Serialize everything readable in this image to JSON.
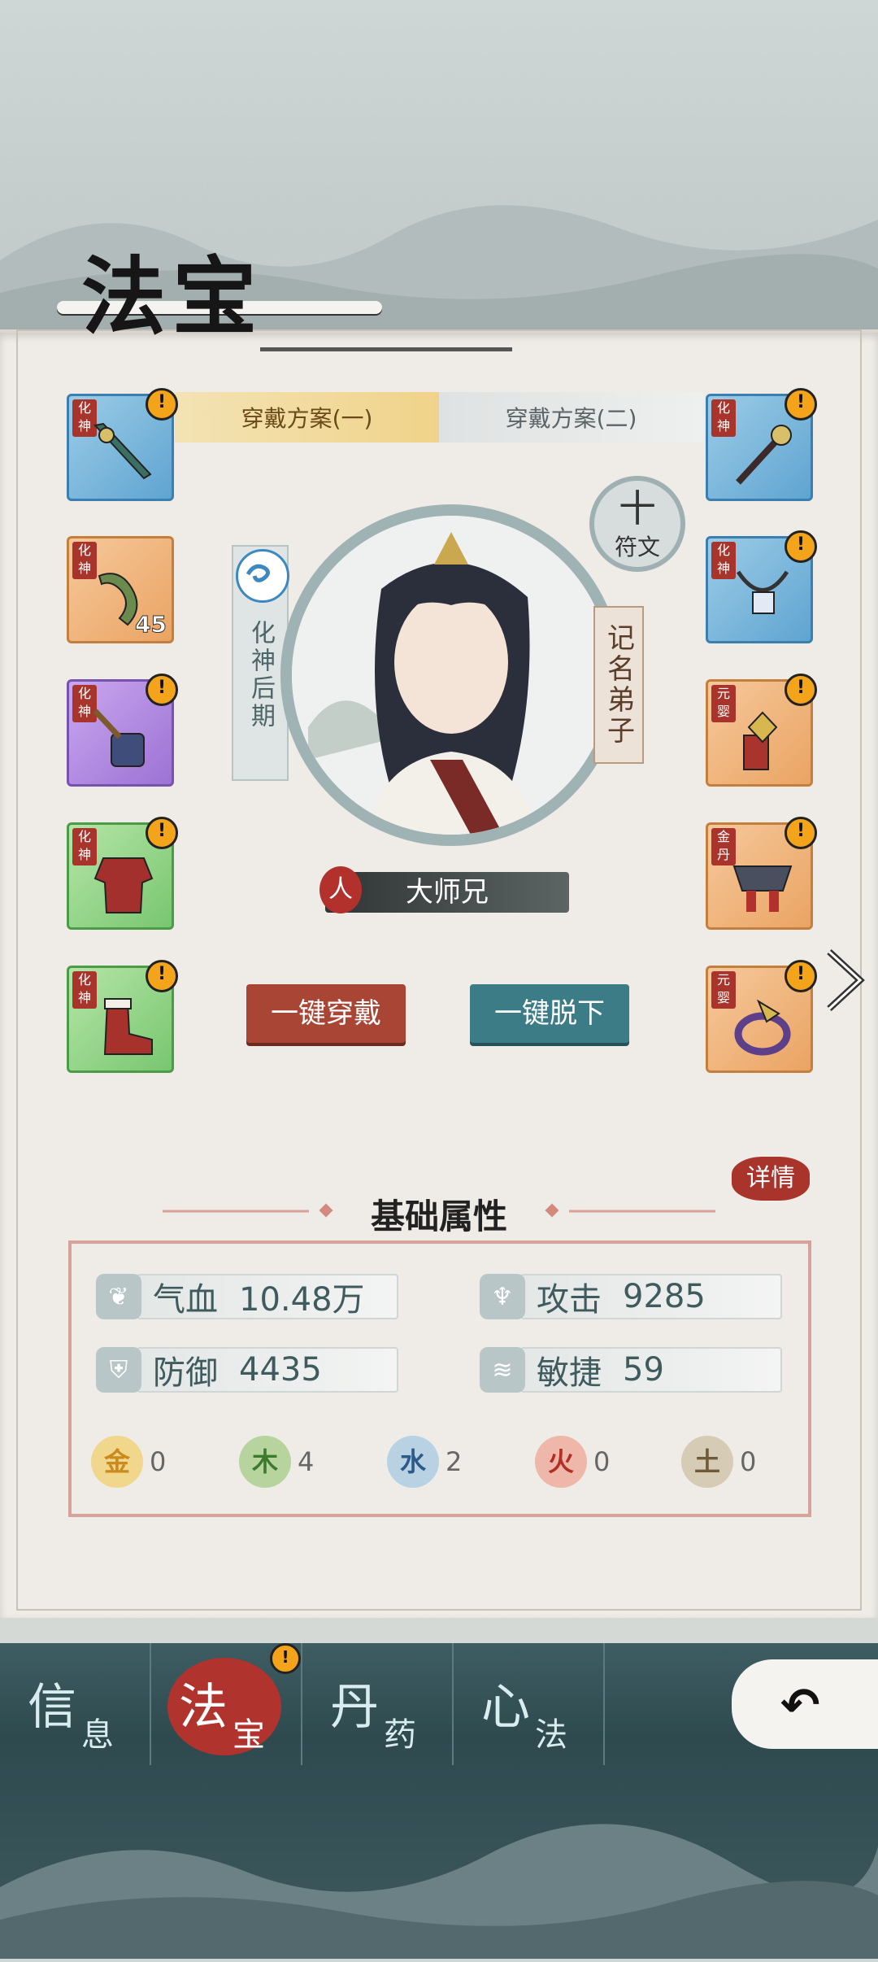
{
  "page": {
    "title": "法宝"
  },
  "loadout_tabs": [
    "穿戴方案(一)",
    "穿戴方案(二)"
  ],
  "left_slots": [
    {
      "tier": "化神",
      "rarity": "blue",
      "item": "jade-sword",
      "alert": "!"
    },
    {
      "tier": "化神",
      "rarity": "orange",
      "item": "dragon-blade",
      "level": "45"
    },
    {
      "tier": "化神",
      "rarity": "purple",
      "item": "crystal-hammer",
      "alert": "!"
    },
    {
      "tier": "化神",
      "rarity": "green",
      "item": "red-robe",
      "alert": "!"
    },
    {
      "tier": "化神",
      "rarity": "green",
      "item": "fur-boots",
      "alert": "!"
    }
  ],
  "right_slots": [
    {
      "tier": "化神",
      "rarity": "blue",
      "item": "hairpin",
      "alert": "!"
    },
    {
      "tier": "化神",
      "rarity": "blue",
      "item": "jade-necklace",
      "alert": "!"
    },
    {
      "tier": "元婴",
      "rarity": "orange",
      "item": "gem-bracer",
      "alert": "!"
    },
    {
      "tier": "金丹",
      "rarity": "orange",
      "item": "belt",
      "alert": "!"
    },
    {
      "tier": "元婴",
      "rarity": "orange",
      "item": "dragon-ring",
      "alert": "!"
    }
  ],
  "character": {
    "realm": "化神后期",
    "rank": "记名弟子",
    "race": "人",
    "name": "大师兄",
    "rune_label": "符文",
    "rune_plus": "十"
  },
  "actions": {
    "equip_all": "一键穿戴",
    "unequip_all": "一键脱下"
  },
  "attributes": {
    "title": "基础属性",
    "detail": "详情",
    "stats": [
      {
        "icon": "blood-icon",
        "label": "气血",
        "value": "10.48万"
      },
      {
        "icon": "attack-icon",
        "label": "攻击",
        "value": "9285"
      },
      {
        "icon": "shield-icon",
        "label": "防御",
        "value": "4435"
      },
      {
        "icon": "agility-icon",
        "label": "敏捷",
        "value": "59"
      }
    ],
    "elements": [
      {
        "char": "金",
        "value": "0",
        "color": "#e9c767",
        "text_color": "#c98a1e"
      },
      {
        "char": "木",
        "value": "4",
        "color": "#b7d49f",
        "text_color": "#3d7a2e"
      },
      {
        "char": "水",
        "value": "2",
        "color": "#b8d2e4",
        "text_color": "#2c5a8a"
      },
      {
        "char": "火",
        "value": "0",
        "color": "#efb7aa",
        "text_color": "#b12f23"
      },
      {
        "char": "土",
        "value": "0",
        "color": "#d6cbb4",
        "text_color": "#6e5b3c"
      }
    ]
  },
  "nav": [
    {
      "big": "信",
      "small": "息"
    },
    {
      "big": "法",
      "small": "宝"
    },
    {
      "big": "丹",
      "small": "药"
    },
    {
      "big": "心",
      "small": "法"
    }
  ],
  "nav_alert": "!",
  "back_arrow": "↶"
}
